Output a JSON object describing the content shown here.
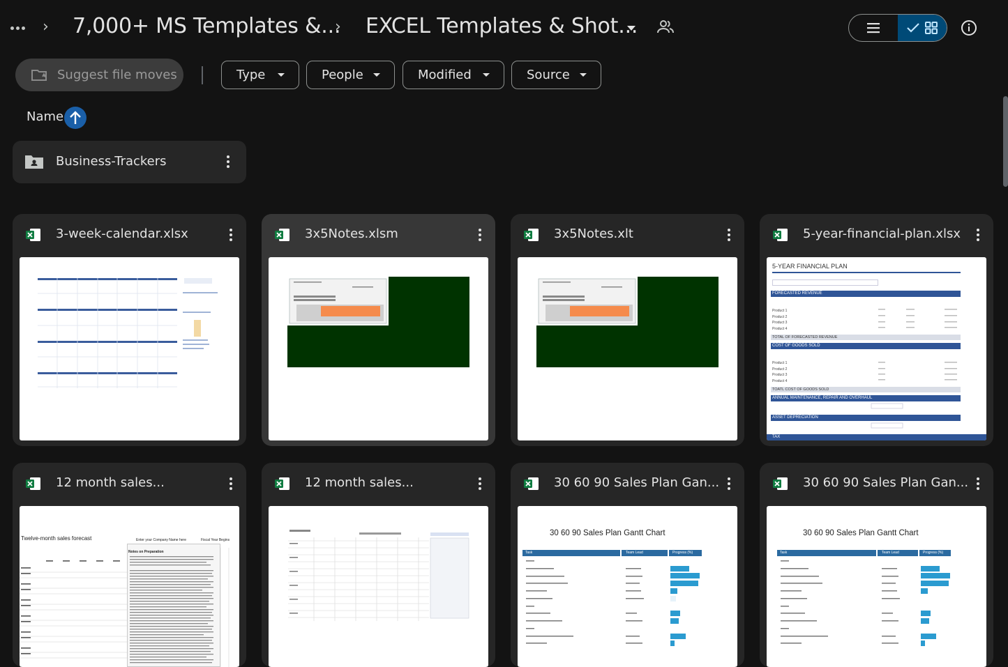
{
  "breadcrumb": {
    "parent": "7,000+ MS Templates &...",
    "current": "EXCEL Templates & Shot..."
  },
  "icons": {
    "more": "more-horiz-icon",
    "share": "people-icon",
    "list_view": "list-icon",
    "grid_view": "grid-icon",
    "info": "info-icon",
    "excel": "excel-icon",
    "folder": "shared-folder-icon"
  },
  "filters": {
    "suggest": "Suggest file moves",
    "chips": [
      "Type",
      "People",
      "Modified",
      "Source"
    ]
  },
  "sort": {
    "label": "Name",
    "direction": "ascending"
  },
  "folders": [
    {
      "name": "Business-Trackers"
    }
  ],
  "files": [
    {
      "name": "3-week-calendar.xlsx"
    },
    {
      "name": "3x5Notes.xlsm"
    },
    {
      "name": "3x5Notes.xlt"
    },
    {
      "name": "5-year-financial-plan.xlsx"
    },
    {
      "name": "12 month sales..."
    },
    {
      "name": "12 month sales..."
    },
    {
      "name": "30 60 90 Sales Plan Gan..."
    },
    {
      "name": "30 60 90 Sales Plan Gan..."
    }
  ],
  "thumbnails": {
    "financial": {
      "title": "5-YEAR FINANCIAL PLAN",
      "sections": [
        "FORECASTED REVENUE",
        "TOTAL OF FORECASTED REVENUE",
        "COST OF GOODS SOLD",
        "TOATL COST OF GOODS SOLD",
        "ANNUAL MAINTENANCE, REPAIR AND OVERHAUL",
        "ASSET DEPRECIATION",
        "TAX"
      ],
      "products": [
        "Product 1",
        "Product 2",
        "Product 3",
        "Product 4"
      ]
    },
    "sales_forecast": {
      "title": "Twelve-month sales forecast",
      "company": "Enter your Company Name here",
      "fiscal": "Fiscal Year Begins",
      "notes_title": "Notes on Preparation"
    },
    "gantt": {
      "title": "30 60 90 Sales Plan Gantt Chart",
      "headers": [
        "Task",
        "Team Lead",
        "Progress (%)"
      ]
    }
  },
  "colors": {
    "background": "#131313",
    "card": "#262626",
    "card_selected": "#373737",
    "accent": "#004a77",
    "excel_green": "#107c41",
    "sheet_green": "#003300",
    "fin_blue": "#2f5597",
    "gantt_blue": "#2b7bb9"
  }
}
